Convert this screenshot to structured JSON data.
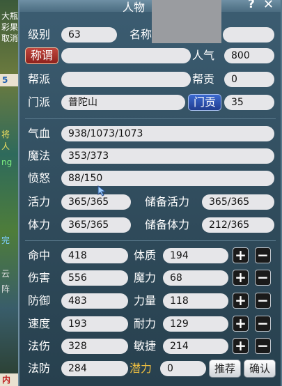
{
  "window": {
    "title": "人物",
    "help": "?",
    "close": "✕"
  },
  "background": {
    "texts": [
      "大瓶",
      "彩果",
      "取消",
      "5",
      "将",
      "人",
      "ng",
      "完",
      "云",
      "阵",
      "内"
    ]
  },
  "profile": {
    "level_label": "级别",
    "level": "63",
    "name_label": "名称",
    "name": "",
    "title_button": "称谓",
    "title_value": "",
    "popularity_label": "人气",
    "popularity": "800",
    "gang_label": "帮派",
    "gang": "",
    "gang_contrib_label": "帮贡",
    "gang_contrib": "0",
    "sect_label": "门派",
    "sect": "普陀山",
    "sect_contrib_button": "门贡",
    "sect_contrib": "35"
  },
  "vitals": {
    "hp_label": "气血",
    "hp": "938/1073/1073",
    "mp_label": "魔法",
    "mp": "353/373",
    "rage_label": "愤怒",
    "rage": "88/150",
    "vitality_label": "活力",
    "vitality": "365/365",
    "reserve_vitality_label": "储备活力",
    "reserve_vitality": "365/365",
    "stamina_label": "体力",
    "stamina": "365/365",
    "reserve_stamina_label": "储备体力",
    "reserve_stamina": "212/365"
  },
  "combat_stats": [
    {
      "label": "命中",
      "value": "418"
    },
    {
      "label": "伤害",
      "value": "556"
    },
    {
      "label": "防御",
      "value": "483"
    },
    {
      "label": "速度",
      "value": "193"
    },
    {
      "label": "法伤",
      "value": "328"
    },
    {
      "label": "法防",
      "value": "284"
    }
  ],
  "attributes": [
    {
      "label": "体质",
      "value": "194",
      "plus": "+",
      "minus": "−"
    },
    {
      "label": "魔力",
      "value": "68",
      "plus": "+",
      "minus": "−"
    },
    {
      "label": "力量",
      "value": "118",
      "plus": "+",
      "minus": "−"
    },
    {
      "label": "耐力",
      "value": "129",
      "plus": "+",
      "minus": "−"
    },
    {
      "label": "敏捷",
      "value": "214",
      "plus": "+",
      "minus": "−"
    }
  ],
  "potential": {
    "label": "潜力",
    "value": "0"
  },
  "actions": {
    "recommend": "推荐",
    "confirm": "确认"
  },
  "colors": {
    "panel": "#2f4a5a",
    "field": "#e6e6e9",
    "red_button": "#a6332c",
    "blue_button": "#2e55b8",
    "potential_label": "#f0c040"
  }
}
